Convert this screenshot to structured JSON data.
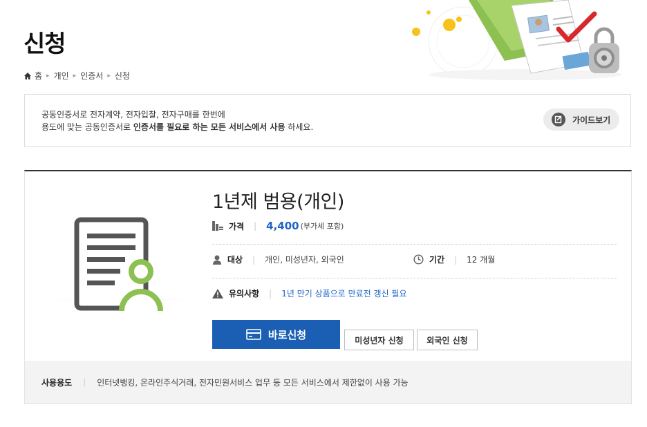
{
  "page": {
    "title": "신청",
    "breadcrumb": [
      "홈",
      "개인",
      "인증서",
      "신청"
    ]
  },
  "notice": {
    "line1": "공동인증서로 전자계약, 전자입찰, 전자구매를 한번에",
    "line2_prefix": "용도에 맞는 공동인증서로 ",
    "line2_bold": "인증서를 필요로 하는 모든 서비스에서 사용",
    "line2_suffix": " 하세요.",
    "guide_button": "가이드보기"
  },
  "product": {
    "title": "1년제 범용(개인)",
    "price_label": "가격",
    "price_value": "4,400",
    "price_note": "(부가세 포함)",
    "target_label": "대상",
    "target_value": "개인, 미성년자, 외국인",
    "period_label": "기간",
    "period_value": "12 개월",
    "caution_label": "유의사항",
    "caution_value": "1년 만기 상품으로 만료전 갱신 필요",
    "apply_button": "바로신청",
    "minor_button": "미성년자 신청",
    "foreign_button": "외국인 신청",
    "usage_label": "사용용도",
    "usage_value": "인터넷뱅킹, 온라인주식거래, 전자민원서비스 업무 등 모든 서비스에서 제한없이 사용 가능"
  },
  "colors": {
    "accent": "#1a5fb4",
    "link": "#1e64c8",
    "icon_green": "#8cc152",
    "icon_gray": "#555555"
  },
  "icons": [
    "home-icon",
    "guide-icon",
    "document-user-icon",
    "price-icon",
    "user-icon",
    "clock-icon",
    "warning-icon",
    "card-icon"
  ]
}
